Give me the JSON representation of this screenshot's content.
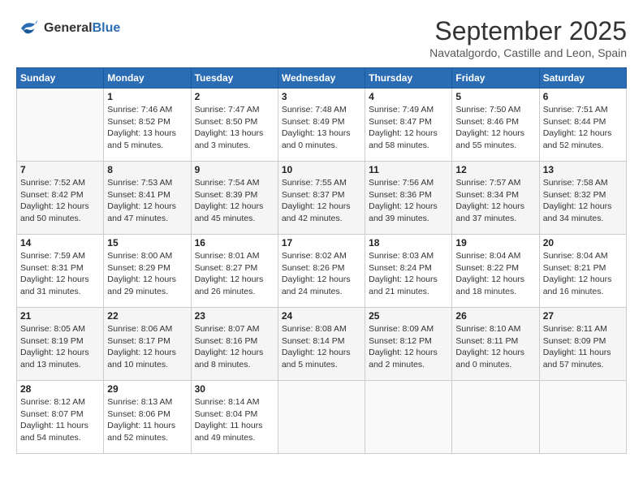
{
  "header": {
    "logo_line1": "General",
    "logo_line2": "Blue",
    "month_title": "September 2025",
    "subtitle": "Navatalgordo, Castille and Leon, Spain"
  },
  "weekdays": [
    "Sunday",
    "Monday",
    "Tuesday",
    "Wednesday",
    "Thursday",
    "Friday",
    "Saturday"
  ],
  "weeks": [
    [
      {
        "day": "",
        "info": ""
      },
      {
        "day": "1",
        "info": "Sunrise: 7:46 AM\nSunset: 8:52 PM\nDaylight: 13 hours\nand 5 minutes."
      },
      {
        "day": "2",
        "info": "Sunrise: 7:47 AM\nSunset: 8:50 PM\nDaylight: 13 hours\nand 3 minutes."
      },
      {
        "day": "3",
        "info": "Sunrise: 7:48 AM\nSunset: 8:49 PM\nDaylight: 13 hours\nand 0 minutes."
      },
      {
        "day": "4",
        "info": "Sunrise: 7:49 AM\nSunset: 8:47 PM\nDaylight: 12 hours\nand 58 minutes."
      },
      {
        "day": "5",
        "info": "Sunrise: 7:50 AM\nSunset: 8:46 PM\nDaylight: 12 hours\nand 55 minutes."
      },
      {
        "day": "6",
        "info": "Sunrise: 7:51 AM\nSunset: 8:44 PM\nDaylight: 12 hours\nand 52 minutes."
      }
    ],
    [
      {
        "day": "7",
        "info": "Sunrise: 7:52 AM\nSunset: 8:42 PM\nDaylight: 12 hours\nand 50 minutes."
      },
      {
        "day": "8",
        "info": "Sunrise: 7:53 AM\nSunset: 8:41 PM\nDaylight: 12 hours\nand 47 minutes."
      },
      {
        "day": "9",
        "info": "Sunrise: 7:54 AM\nSunset: 8:39 PM\nDaylight: 12 hours\nand 45 minutes."
      },
      {
        "day": "10",
        "info": "Sunrise: 7:55 AM\nSunset: 8:37 PM\nDaylight: 12 hours\nand 42 minutes."
      },
      {
        "day": "11",
        "info": "Sunrise: 7:56 AM\nSunset: 8:36 PM\nDaylight: 12 hours\nand 39 minutes."
      },
      {
        "day": "12",
        "info": "Sunrise: 7:57 AM\nSunset: 8:34 PM\nDaylight: 12 hours\nand 37 minutes."
      },
      {
        "day": "13",
        "info": "Sunrise: 7:58 AM\nSunset: 8:32 PM\nDaylight: 12 hours\nand 34 minutes."
      }
    ],
    [
      {
        "day": "14",
        "info": "Sunrise: 7:59 AM\nSunset: 8:31 PM\nDaylight: 12 hours\nand 31 minutes."
      },
      {
        "day": "15",
        "info": "Sunrise: 8:00 AM\nSunset: 8:29 PM\nDaylight: 12 hours\nand 29 minutes."
      },
      {
        "day": "16",
        "info": "Sunrise: 8:01 AM\nSunset: 8:27 PM\nDaylight: 12 hours\nand 26 minutes."
      },
      {
        "day": "17",
        "info": "Sunrise: 8:02 AM\nSunset: 8:26 PM\nDaylight: 12 hours\nand 24 minutes."
      },
      {
        "day": "18",
        "info": "Sunrise: 8:03 AM\nSunset: 8:24 PM\nDaylight: 12 hours\nand 21 minutes."
      },
      {
        "day": "19",
        "info": "Sunrise: 8:04 AM\nSunset: 8:22 PM\nDaylight: 12 hours\nand 18 minutes."
      },
      {
        "day": "20",
        "info": "Sunrise: 8:04 AM\nSunset: 8:21 PM\nDaylight: 12 hours\nand 16 minutes."
      }
    ],
    [
      {
        "day": "21",
        "info": "Sunrise: 8:05 AM\nSunset: 8:19 PM\nDaylight: 12 hours\nand 13 minutes."
      },
      {
        "day": "22",
        "info": "Sunrise: 8:06 AM\nSunset: 8:17 PM\nDaylight: 12 hours\nand 10 minutes."
      },
      {
        "day": "23",
        "info": "Sunrise: 8:07 AM\nSunset: 8:16 PM\nDaylight: 12 hours\nand 8 minutes."
      },
      {
        "day": "24",
        "info": "Sunrise: 8:08 AM\nSunset: 8:14 PM\nDaylight: 12 hours\nand 5 minutes."
      },
      {
        "day": "25",
        "info": "Sunrise: 8:09 AM\nSunset: 8:12 PM\nDaylight: 12 hours\nand 2 minutes."
      },
      {
        "day": "26",
        "info": "Sunrise: 8:10 AM\nSunset: 8:11 PM\nDaylight: 12 hours\nand 0 minutes."
      },
      {
        "day": "27",
        "info": "Sunrise: 8:11 AM\nSunset: 8:09 PM\nDaylight: 11 hours\nand 57 minutes."
      }
    ],
    [
      {
        "day": "28",
        "info": "Sunrise: 8:12 AM\nSunset: 8:07 PM\nDaylight: 11 hours\nand 54 minutes."
      },
      {
        "day": "29",
        "info": "Sunrise: 8:13 AM\nSunset: 8:06 PM\nDaylight: 11 hours\nand 52 minutes."
      },
      {
        "day": "30",
        "info": "Sunrise: 8:14 AM\nSunset: 8:04 PM\nDaylight: 11 hours\nand 49 minutes."
      },
      {
        "day": "",
        "info": ""
      },
      {
        "day": "",
        "info": ""
      },
      {
        "day": "",
        "info": ""
      },
      {
        "day": "",
        "info": ""
      }
    ]
  ]
}
